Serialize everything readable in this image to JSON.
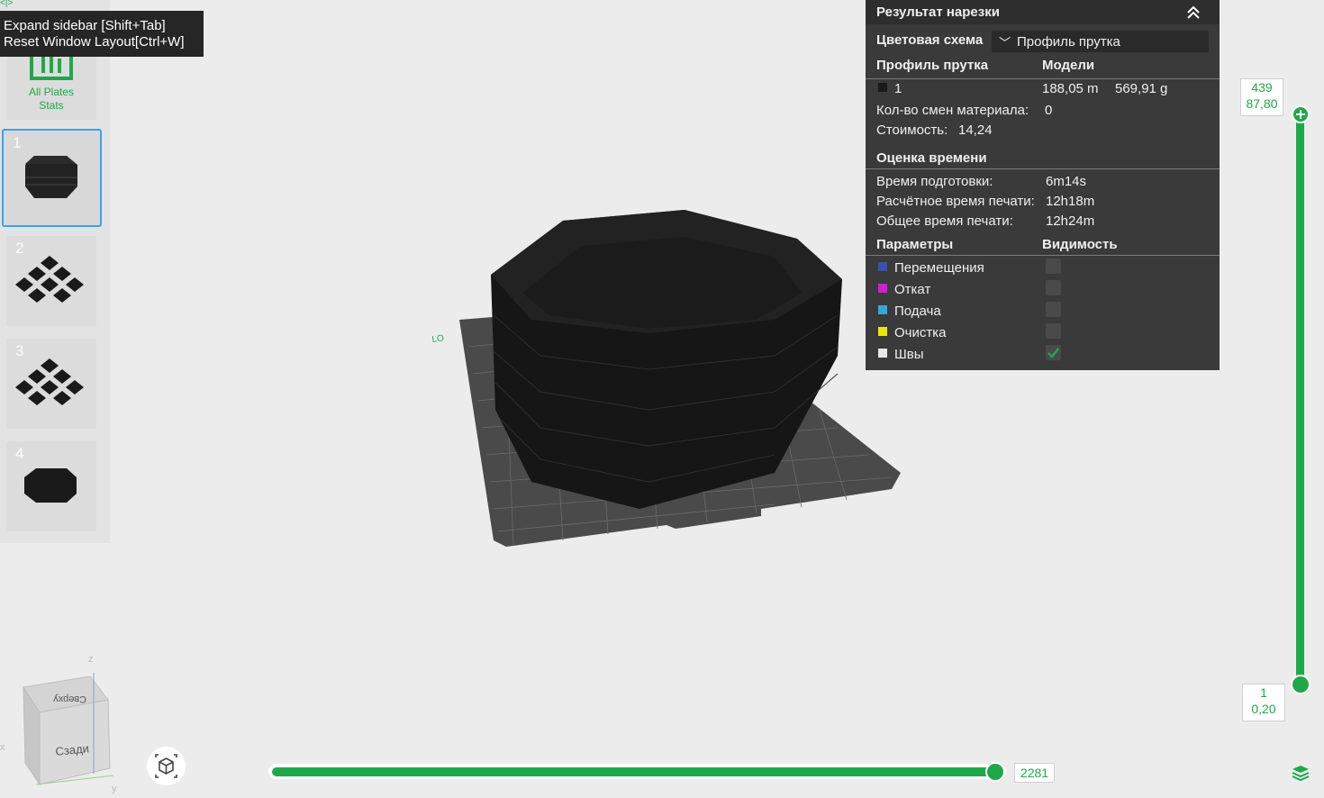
{
  "sidebar": {
    "stats_label_line1": "All Plates",
    "stats_label_line2": "Stats",
    "plates": [
      {
        "number": "1",
        "active": true
      },
      {
        "number": "2",
        "active": false
      },
      {
        "number": "3",
        "active": false
      },
      {
        "number": "4",
        "active": false
      }
    ]
  },
  "tooltip": {
    "line1": "Expand sidebar [Shift+Tab]",
    "line2": "Reset Window Layout[Ctrl+W]"
  },
  "panel": {
    "title": "Результат нарезки",
    "color_scheme_label": "Цветовая схема",
    "color_scheme_value": "Профиль прутка",
    "filament_header": "Профиль прутка",
    "models_header": "Модели",
    "filament_row": {
      "id": "1",
      "length": "188,05 m",
      "weight": "569,91 g",
      "color": "#1a1a1a"
    },
    "material_changes_label": "Кол-во смен материала:",
    "material_changes_value": "0",
    "cost_label": "Стоимость:",
    "cost_value": "14,24",
    "time_header": "Оценка времени",
    "prep_time_label": "Время подготовки:",
    "prep_time_value": "6m14s",
    "print_time_label": "Расчётное время печати:",
    "print_time_value": "12h18m",
    "total_time_label": "Общее время печати:",
    "total_time_value": "12h24m",
    "params_header": "Параметры",
    "visibility_header": "Видимость",
    "params": [
      {
        "label": "Перемещения",
        "color": "#3852b0",
        "visible": false
      },
      {
        "label": "Откат",
        "color": "#d01fd0",
        "visible": false
      },
      {
        "label": "Подача",
        "color": "#3aa6d8",
        "visible": false
      },
      {
        "label": "Очистка",
        "color": "#e8e800",
        "visible": false
      },
      {
        "label": "Швы",
        "color": "#e8e8e8",
        "visible": true
      }
    ]
  },
  "layer_slider": {
    "top_layer": "439",
    "top_height": "87,80",
    "bottom_layer": "1",
    "bottom_height": "0,20"
  },
  "move_slider": {
    "value": "2281"
  },
  "view_cube": {
    "top_face": "Сверху",
    "front_face": "Сзади",
    "axis_x": "x",
    "axis_y": "y",
    "axis_z": "z"
  },
  "bed": {
    "logo": "LO"
  },
  "colors": {
    "accent": "#1fa84a",
    "panel_bg": "#3a3a3a"
  }
}
